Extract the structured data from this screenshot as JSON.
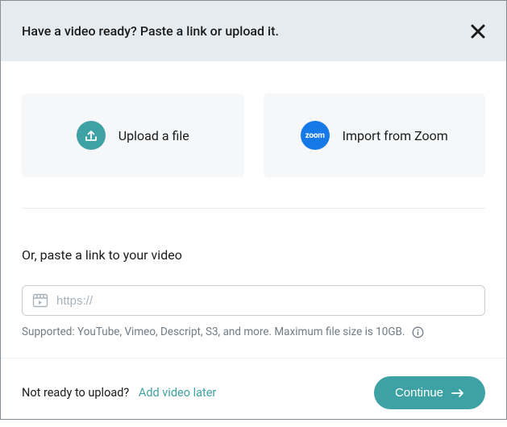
{
  "header": {
    "title": "Have a video ready? Paste a link or upload it."
  },
  "options": {
    "upload": {
      "label": "Upload a file"
    },
    "zoom": {
      "label": "Import from Zoom",
      "icon_text": "zoom"
    }
  },
  "paste": {
    "label": "Or, paste a link to your video",
    "placeholder": "https://",
    "support_text": "Supported: YouTube, Vimeo, Descript, S3, and more. Maximum file size is 10GB."
  },
  "footer": {
    "prompt": "Not ready to upload?",
    "link": "Add video later",
    "continue": "Continue"
  },
  "colors": {
    "teal": "#3ea1a4",
    "blue": "#1579e8"
  }
}
